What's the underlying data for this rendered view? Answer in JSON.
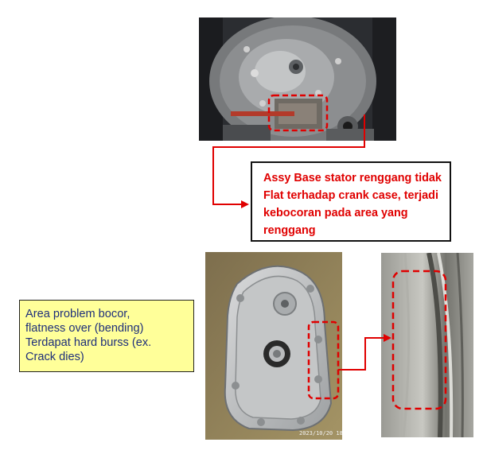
{
  "callout": {
    "text": "Assy Base stator  renggang tidak\nFlat terhadap  crank case, terjadi\nkebocoran pada area yang\nrenggang"
  },
  "note": {
    "text": "Area problem bocor,\nflatness over (bending)\nTerdapat hard burss (ex.\nCrack dies)"
  },
  "photo": {
    "timestamp": "2023/10/20  18:3"
  },
  "colors": {
    "highlight": "#e00000",
    "note_background": "#ffff99",
    "note_text": "#1f2f7a"
  },
  "icons": {
    "highlight_marker": "dashed-red-rounded-rectangle",
    "connector": "red-arrow-line"
  }
}
